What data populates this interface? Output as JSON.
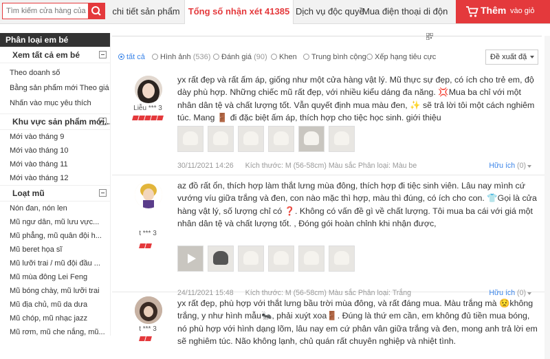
{
  "search": {
    "placeholder": "Tìm kiếm cửa hàng của"
  },
  "tabs": [
    {
      "label": "chi tiết sản phẩm"
    },
    {
      "label": "Tổng số nhận xét",
      "count": "41385"
    },
    {
      "label": "Dịch vụ độc quyền"
    },
    {
      "label": "Mua điện thoại di động"
    }
  ],
  "add_cart": {
    "big": "Thêm",
    "small": "vào giỏ"
  },
  "sidebar": {
    "title": "Phân loại em bé",
    "sections": [
      {
        "heading": "Xem tất cả em bé",
        "items": [
          "Theo doanh số",
          "Bằng sản phẩm mới Theo giá cả",
          "Nhấn vào mục yêu thích"
        ]
      },
      {
        "heading": "Khu vực sản phẩm mới...",
        "items": [
          "Mới vào tháng 9",
          "Mới vào tháng 10",
          "Mới vào tháng 11",
          "Mới vào tháng 12"
        ]
      },
      {
        "heading": "Loạt mũ",
        "items": [
          "Nón đan, nón len",
          "Mũ ngư dân, mũ lưu vực...",
          "Mũ phẳng, mũ quân đội h...",
          "Mũ beret họa sĩ",
          "Mũ lưỡi trai / mũ đội đầu ...",
          "Mũ mùa đông Lei Feng",
          "Mũ bóng chày, mũ lưỡi trai",
          "Mũ địa chủ, mũ da dưa",
          "Mũ chóp, mũ nhạc jazz",
          "Mũ rơm, mũ che nắng, mũ..."
        ]
      }
    ]
  },
  "filters": [
    {
      "label": "tất cả",
      "selected": true
    },
    {
      "label": "Hình ảnh",
      "count": "(536)"
    },
    {
      "label": "Đánh giá",
      "count": "(90)"
    },
    {
      "label": "Khen"
    },
    {
      "label": "Trung bình cộng"
    },
    {
      "label": "Xếp hạng tiêu cực"
    }
  ],
  "sort": {
    "label": "Đề xuất đặ"
  },
  "reviews": [
    {
      "user": "Liễu *** 3",
      "text": "yx rất đẹp và rất ấm áp, giống như một cửa hàng vật lý. Mũ thực sự đẹp, có ích cho trẻ em, độ dày phù hợp. Những chiếc mũ rất đẹp, với nhiều kiểu dáng đa năng. 💢Mua ba chỉ với một nhân dân tệ và chất lượng tốt. Vẫn quyết định mua màu đen, ✨ sẽ trả lời tôi một cách nghiêm túc. Mang 🚪 đi đặc biệt ấm áp, thích hợp cho tiệc học sinh. giới thiệu",
      "date": "30/11/2021 14:26",
      "size": "Kích thước: M (56-58cm)",
      "color": "Màu sắc Phân loại: Màu be",
      "helpful": "Hữu ích",
      "helpful_count": "(0)"
    },
    {
      "user": "t *** 3",
      "text": "az đồ rất ổn, thích hợp làm thắt lưng mùa đông, thích hợp đi tiệc sinh viên. Lâu nay mình cứ vướng víu giữa trắng và đen, con nào mặc thì hợp, màu thì đúng, có ích cho con. 👕Gọi là cửa hàng vật lý, số lượng chỉ có ❓. Không có vấn đề gì về chất lượng. Tôi mua ba cái với giá một nhân dân tệ và chất lượng tốt. , Đóng gói hoàn chỉnh khi nhận được,",
      "date": "24/11/2021 15:48",
      "size": "Kích thước: M (56-58cm)",
      "color": "Màu sắc Phân loại: Trắng",
      "helpful": "Hữu ích",
      "helpful_count": "(0)"
    },
    {
      "user": "t *** 3",
      "text": "yx rất đẹp, phù hợp với thắt lưng bầu trời mùa đông, và rất đáng mua. Màu trắng mà 😟không trắng, y như hình mẫu🐜, phải xuýt xoa🚪. Đúng là thứ em cần, em không đủ tiền mua bóng, nó phù hợp với hình dạng lõm, lâu nay em cứ phân vân giữa trắng và đen, mong anh trả lời em sẽ nghiêm túc. Não không lạnh, chủ quán rất chuyên nghiệp và nhiệt tình."
    }
  ]
}
